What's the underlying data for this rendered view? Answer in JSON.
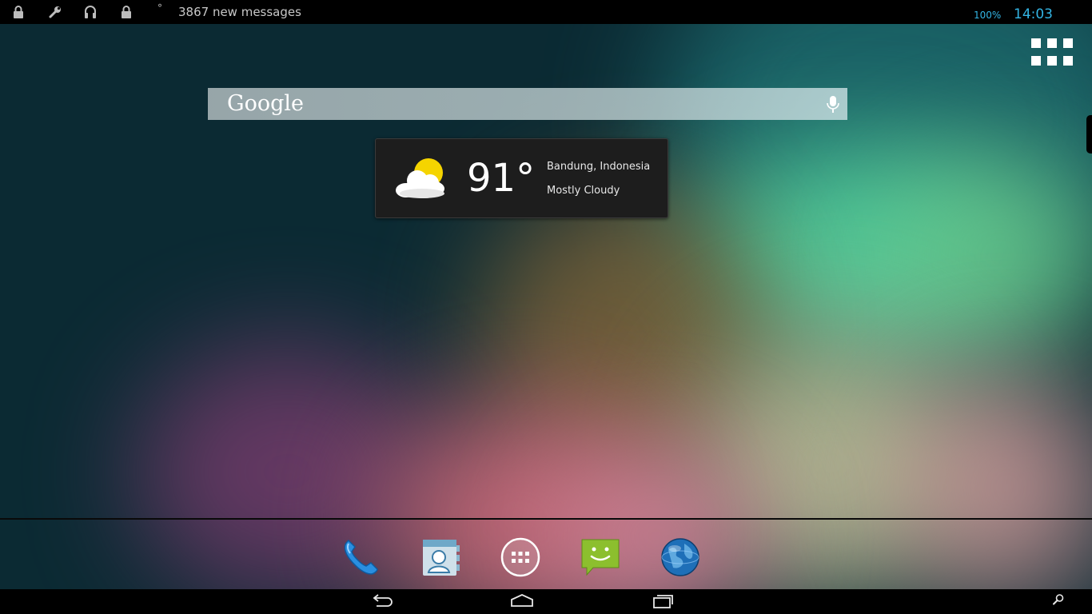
{
  "status_bar": {
    "degree_symbol": "°",
    "notification_text": "3867 new messages",
    "battery": "100%",
    "clock": "14:03",
    "icons": [
      "lock-icon",
      "wrench-icon",
      "headset-icon",
      "lock-icon"
    ]
  },
  "search": {
    "logo_text": "Google",
    "mic_icon": "mic-icon"
  },
  "weather": {
    "temperature": "91°",
    "location": "Bandung, Indonesia",
    "condition": "Mostly Cloudy",
    "icon": "partly-cloudy-icon"
  },
  "dock": {
    "items": [
      "phone-icon",
      "contacts-icon",
      "all-apps-icon",
      "messaging-icon",
      "browser-icon"
    ]
  },
  "nav": {
    "buttons": [
      "back-icon",
      "home-icon",
      "recent-apps-icon",
      "search-icon"
    ]
  },
  "colors": {
    "accent": "#33b5e5",
    "status_bar": "#000000",
    "widget_bg": "#1d1d1d"
  }
}
